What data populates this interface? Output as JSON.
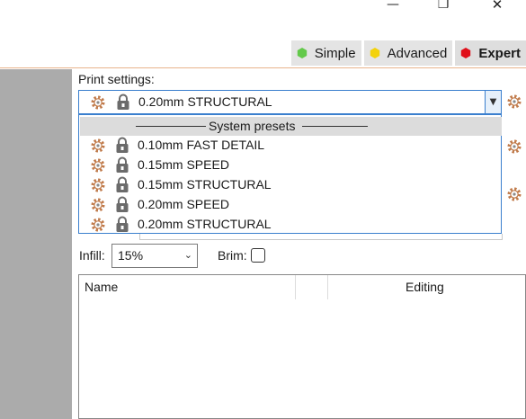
{
  "window": {
    "minimize_glyph": "—",
    "maximize_glyph": "❐",
    "close_glyph": "✕"
  },
  "modes": [
    {
      "label": "Simple",
      "color": "#63c94a"
    },
    {
      "label": "Advanced",
      "color": "#f3d20b"
    },
    {
      "label": "Expert",
      "color": "#e0101a"
    }
  ],
  "print_settings": {
    "label": "Print settings:",
    "selected": "0.20mm STRUCTURAL",
    "dropdown_header": "System presets",
    "presets": [
      "0.10mm FAST DETAIL",
      "0.15mm SPEED",
      "0.15mm STRUCTURAL",
      "0.20mm SPEED",
      "0.20mm STRUCTURAL"
    ]
  },
  "infill": {
    "label": "Infill:",
    "value": "15%"
  },
  "brim": {
    "label": "Brim:",
    "checked": false
  },
  "table": {
    "columns": [
      "Name",
      "",
      "Editing"
    ]
  },
  "colors": {
    "accent_blue": "#3a7fce",
    "orange_rule": "#e9b48c",
    "gear": "#c07a4a",
    "lock": "#6b6b6b"
  },
  "icons": {
    "gear": "gear-icon",
    "lock": "lock-icon"
  }
}
